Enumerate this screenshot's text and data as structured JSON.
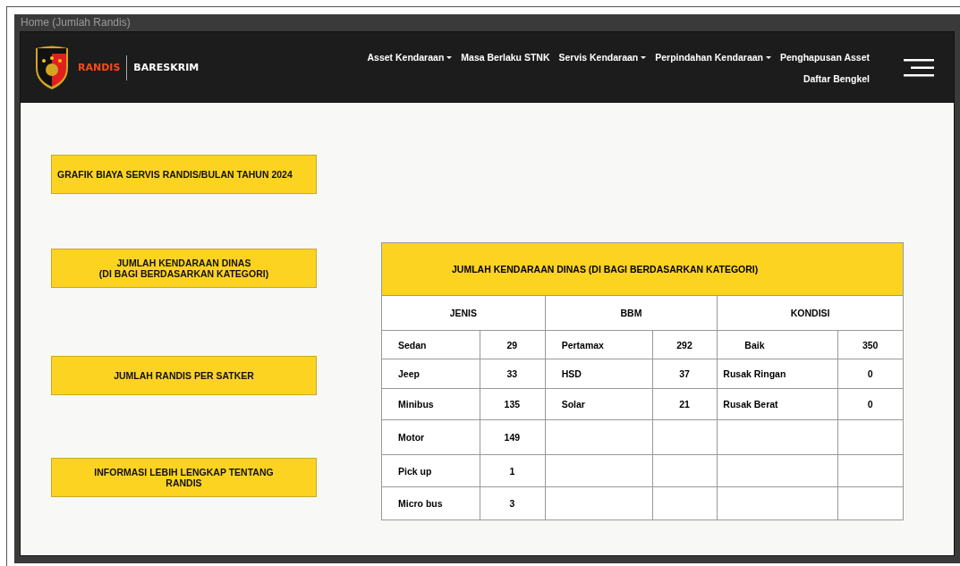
{
  "window": {
    "title": "Home (Jumlah Randis)"
  },
  "navbar": {
    "brand": "RANDIS",
    "unit": "BARESKRIM",
    "items": [
      {
        "label": "Asset Kendaraan",
        "dropdown": true
      },
      {
        "label": "Masa Berlaku STNK",
        "dropdown": false
      },
      {
        "label": "Servis Kendaraan",
        "dropdown": true
      },
      {
        "label": "Perpindahan Kendaraan",
        "dropdown": true
      },
      {
        "label": "Penghapusan Asset",
        "dropdown": false
      },
      {
        "label": "Daftar Bengkel",
        "dropdown": false
      }
    ]
  },
  "side_buttons": [
    {
      "label": "GRAFIK BIAYA SERVIS RANDIS/BULAN TAHUN 2024"
    },
    {
      "label": "JUMLAH KENDARAAN DINAS\n(DI BAGI BERDASARKAN KATEGORI)"
    },
    {
      "label": "JUMLAH RANDIS PER SATKER"
    },
    {
      "label": "INFORMASI LEBIH LENGKAP TENTANG\nRANDIS"
    }
  ],
  "table": {
    "title": "JUMLAH KENDARAAN DINAS (DI BAGI BERDASARKAN KATEGORI)",
    "sections": [
      {
        "heading": "JENIS",
        "items": [
          {
            "label": "Sedan",
            "value": "29"
          },
          {
            "label": "Jeep",
            "value": "33"
          },
          {
            "label": "Minibus",
            "value": "135"
          },
          {
            "label": "Motor",
            "value": "149"
          },
          {
            "label": "Pick up",
            "value": "1"
          },
          {
            "label": "Micro bus",
            "value": "3"
          }
        ]
      },
      {
        "heading": "BBM",
        "items": [
          {
            "label": "Pertamax",
            "value": "292"
          },
          {
            "label": "HSD",
            "value": "37"
          },
          {
            "label": "Solar",
            "value": "21"
          }
        ]
      },
      {
        "heading": "KONDISI",
        "items": [
          {
            "label": "Baik",
            "value": "350"
          },
          {
            "label": "Rusak Ringan",
            "value": "0"
          },
          {
            "label": "Rusak Berat",
            "value": "0"
          }
        ]
      }
    ]
  }
}
